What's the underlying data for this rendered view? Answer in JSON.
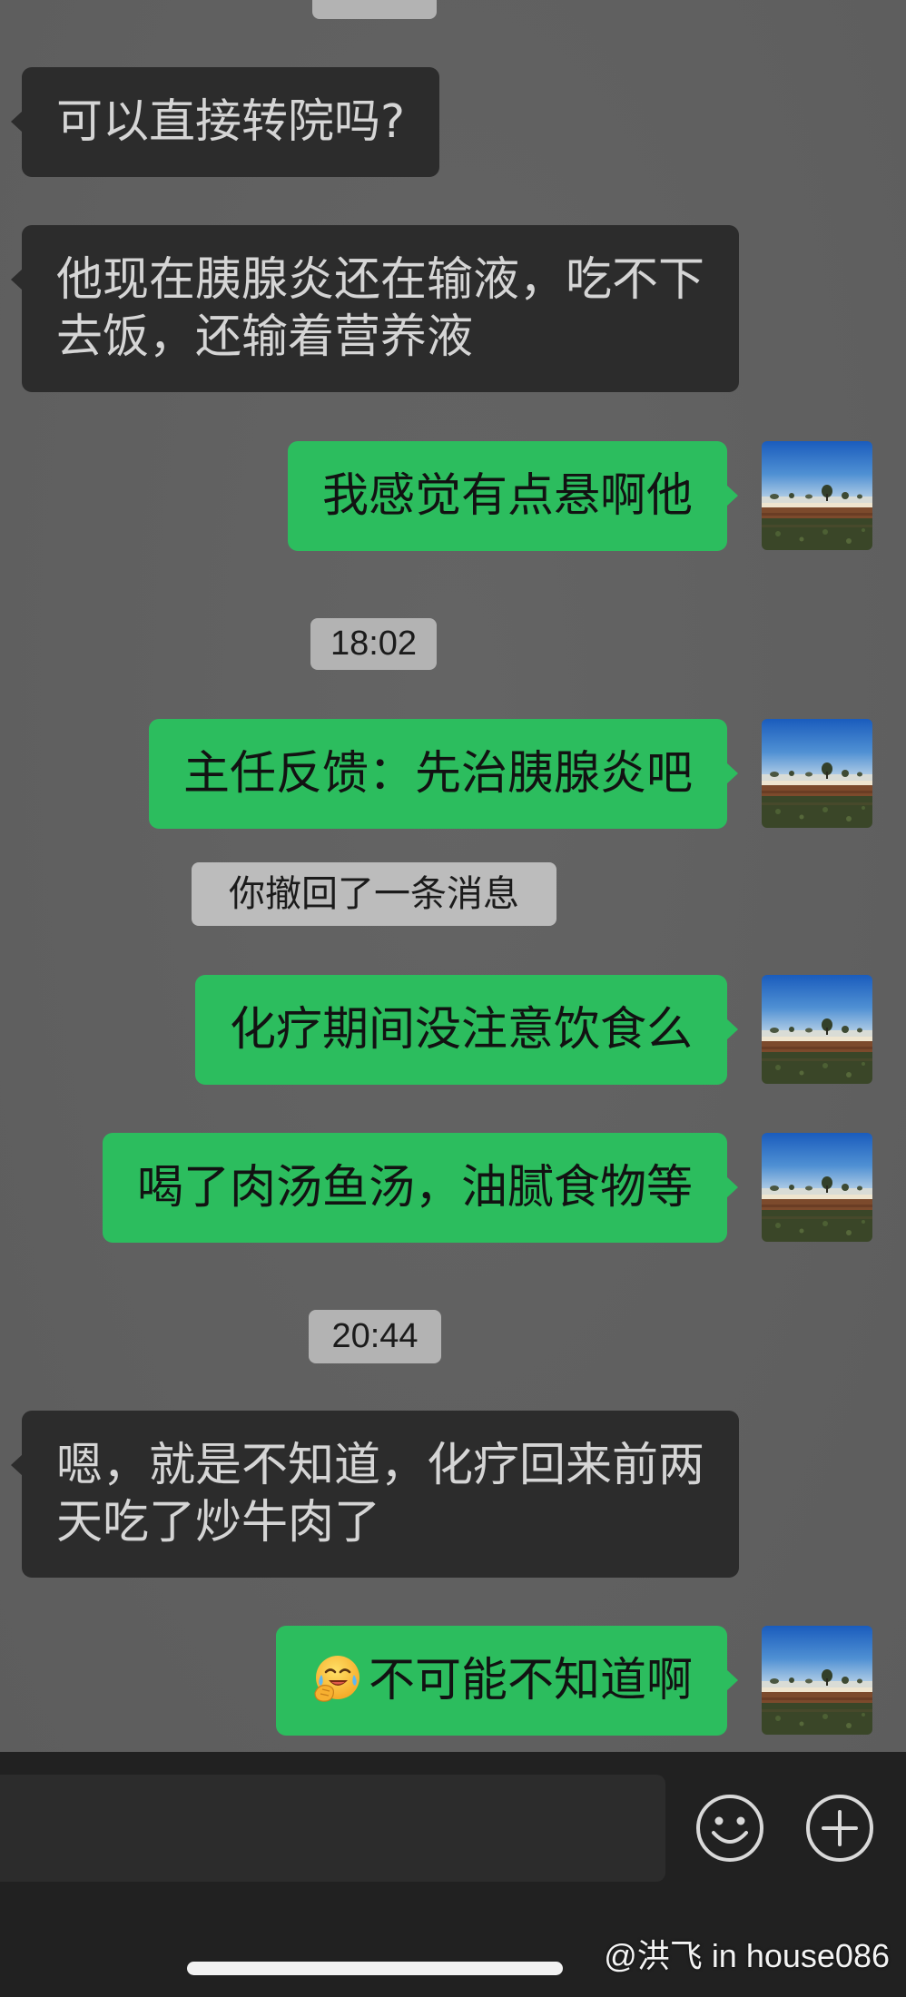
{
  "colors": {
    "background": "#606060",
    "sent_bubble": "#2cbd5e",
    "received_bubble": "#2c2c2c"
  },
  "chat": {
    "messages": [
      {
        "lines": [
          "可以直接转院吗?"
        ]
      },
      {
        "lines": [
          "他现在胰腺炎还在输液，吃不下",
          "去饭，还输着营养液"
        ]
      },
      {
        "lines": [
          "我感觉有点悬啊他"
        ]
      },
      {
        "lines": [
          "主任反馈：先治胰腺炎吧"
        ]
      },
      {
        "lines": [
          "化疗期间没注意饮食么"
        ]
      },
      {
        "lines": [
          "喝了肉汤鱼汤，油腻食物等"
        ]
      },
      {
        "lines": [
          "嗯，就是不知道，化疗回来前两",
          "天吃了炒牛肉了"
        ]
      },
      {
        "emoji_icon": "facepalm-emoji-icon",
        "lines": [
          "不可能不知道啊"
        ]
      }
    ],
    "timestamps": [
      "18:02",
      "20:44"
    ],
    "system_notice": "你撤回了一条消息"
  },
  "input_bar": {
    "emoji_button_icon": "smiley-icon",
    "more_button_icon": "plus-circle-icon"
  },
  "watermark": "@洪飞 in house086"
}
